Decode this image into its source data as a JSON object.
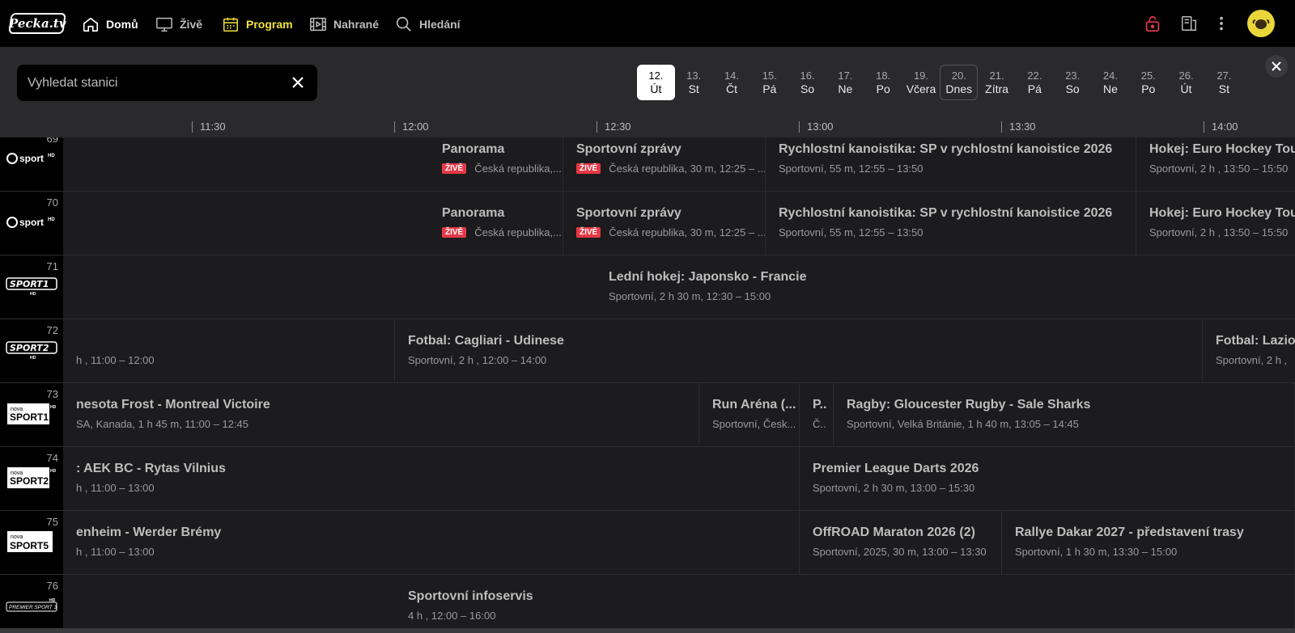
{
  "brand": {
    "logo_text": "Pecka.tv"
  },
  "nav": {
    "home": "Domů",
    "live": "Živě",
    "program": "Program",
    "recorded": "Nahrané",
    "search": "Hledání"
  },
  "search": {
    "placeholder": "Vyhledat stanici",
    "value": ""
  },
  "dates": [
    {
      "num": "12.",
      "day": "Út"
    },
    {
      "num": "13.",
      "day": "St"
    },
    {
      "num": "14.",
      "day": "Čt"
    },
    {
      "num": "15.",
      "day": "Pá"
    },
    {
      "num": "16.",
      "day": "So"
    },
    {
      "num": "17.",
      "day": "Ne"
    },
    {
      "num": "18.",
      "day": "Po"
    },
    {
      "num": "19.",
      "day": "Včera"
    },
    {
      "num": "20.",
      "day": "Dnes"
    },
    {
      "num": "21.",
      "day": "Zítra"
    },
    {
      "num": "22.",
      "day": "Pá"
    },
    {
      "num": "23.",
      "day": "So"
    },
    {
      "num": "24.",
      "day": "Ne"
    },
    {
      "num": "25.",
      "day": "Po"
    },
    {
      "num": "26.",
      "day": "Út"
    },
    {
      "num": "27.",
      "day": "St"
    }
  ],
  "timeline": [
    "11:30",
    "12:00",
    "12:30",
    "13:00",
    "13:30",
    "14:00"
  ],
  "live_badge": "ŽIVĚ",
  "channels": [
    {
      "number": "69",
      "logo": "sport HD",
      "programs": [
        {
          "title": "Panorama",
          "meta": "Česká republika,...",
          "live": true
        },
        {
          "title": "Sportovní zprávy",
          "meta": "Česká republika, 30 m, 12:25 – ...",
          "live": true
        },
        {
          "title": "Rychlostní kanoistika: SP v rychlostní kanoistice 2026",
          "meta": "Sportovní, 55 m, 12:55 – 13:50"
        },
        {
          "title": "Hokej: Euro Hockey Tou",
          "meta": "Sportovní, 2 h , 13:50 – 15:50"
        }
      ]
    },
    {
      "number": "70",
      "logo": "sport HD",
      "programs": [
        {
          "title": "Panorama",
          "meta": "Česká republika,...",
          "live": true
        },
        {
          "title": "Sportovní zprávy",
          "meta": "Česká republika, 30 m, 12:25 – ...",
          "live": true
        },
        {
          "title": "Rychlostní kanoistika: SP v rychlostní kanoistice 2026",
          "meta": "Sportovní, 55 m, 12:55 – 13:50"
        },
        {
          "title": "Hokej: Euro Hockey Tou",
          "meta": "Sportovní, 2 h , 13:50 – 15:50"
        }
      ]
    },
    {
      "number": "71",
      "logo": "SPORT1",
      "programs": [
        {
          "title": "Lední hokej: Japonsko - Francie",
          "meta": "Sportovní, 2 h 30 m, 12:30 – 15:00"
        }
      ]
    },
    {
      "number": "72",
      "logo": "SPORT2",
      "programs": [
        {
          "title": "",
          "meta": "h , 11:00 – 12:00"
        },
        {
          "title": "Fotbal: Cagliari - Udinese",
          "meta": "Sportovní, 2 h , 12:00 – 14:00"
        },
        {
          "title": "Fotbal: Lazio",
          "meta": "Sportovní, 2 h ,"
        }
      ]
    },
    {
      "number": "73",
      "logo": "nova SPORT1",
      "programs": [
        {
          "title": "nesota Frost - Montreal Victoire",
          "meta": "SA, Kanada, 1 h 45 m, 11:00 – 12:45"
        },
        {
          "title": "Run Aréna (...",
          "meta": "Sportovní, Česk..."
        },
        {
          "title": "P..",
          "meta": "Č.."
        },
        {
          "title": "Ragby: Gloucester Rugby - Sale Sharks",
          "meta": "Sportovní, Velká Británie, 1 h 40 m, 13:05 – 14:45"
        }
      ]
    },
    {
      "number": "74",
      "logo": "nova SPORT2",
      "programs": [
        {
          "title": ": AEK BC - Rytas Vilnius",
          "meta": "h , 11:00 – 13:00"
        },
        {
          "title": "Premier League Darts 2026",
          "meta": "Sportovní, 2 h 30 m, 13:00 – 15:30"
        }
      ]
    },
    {
      "number": "75",
      "logo": "nova SPORT5",
      "programs": [
        {
          "title": "enheim - Werder Brémy",
          "meta": "h , 11:00 – 13:00"
        },
        {
          "title": "OffROAD Maraton 2026 (2)",
          "meta": "Sportovní, 2025, 30 m, 13:00 – 13:30"
        },
        {
          "title": "Rallye Dakar 2027 - představení trasy",
          "meta": "Sportovní, 1 h 30 m, 13:30 – 15:00"
        }
      ]
    },
    {
      "number": "76",
      "logo": "PREMIER SPORT 3",
      "programs": [
        {
          "title": "Sportovní infoservis",
          "meta": "4 h , 12:00 – 16:00"
        }
      ]
    }
  ]
}
